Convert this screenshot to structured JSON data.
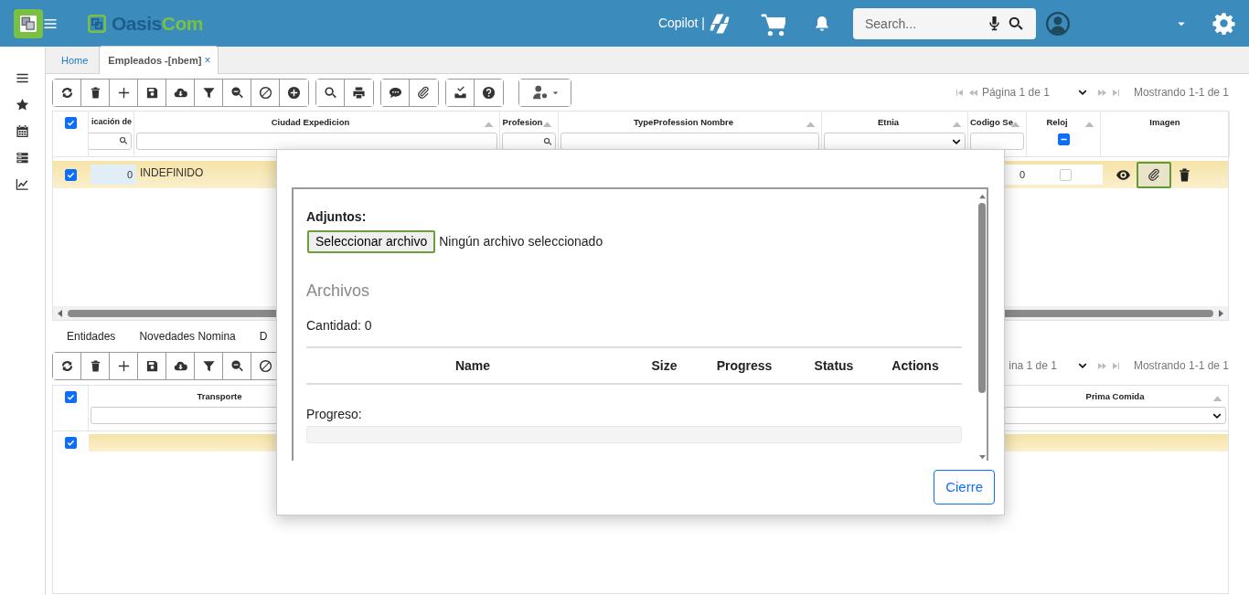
{
  "header": {
    "brand_parts": [
      "Oasis",
      "Com"
    ],
    "copilot_label": "Copilot |",
    "search": {
      "placeholder": "Search..."
    }
  },
  "tabs": [
    {
      "label": "Home",
      "selected": false,
      "closable": false
    },
    {
      "label": "Empleados -[nbem]",
      "selected": true,
      "closable": true,
      "close_glyph": "×"
    }
  ],
  "pagination": {
    "page_text": "Página 1 de 1",
    "showing": "Mostrando 1-1 de 1"
  },
  "grid": {
    "select_all_checked": true,
    "columns": [
      {
        "label": "icación de",
        "sortable": false,
        "kind": "search"
      },
      {
        "label": "Ciudad Expedicion",
        "sortable": true,
        "kind": "text"
      },
      {
        "label": "Profesion",
        "sortable": true,
        "kind": "search"
      },
      {
        "label": "TypeProfession Nombre",
        "sortable": true,
        "kind": "text"
      },
      {
        "label": "Etnia",
        "sortable": true,
        "kind": "select"
      },
      {
        "label": "Codigo Se",
        "sortable": true,
        "kind": "text"
      },
      {
        "label": "Reloj",
        "sortable": true,
        "kind": "checkbox",
        "indeterminate": true
      },
      {
        "label": "Imagen",
        "sortable": false,
        "kind": "actions"
      }
    ],
    "rows": [
      {
        "selected": true,
        "code": "0",
        "ciudad": "INDEFINIDO",
        "codigo": "0",
        "reloj": false,
        "attach_highlighted": true
      }
    ]
  },
  "subtabs": [
    "Entidades",
    "Novedades Nomina",
    "D"
  ],
  "pagination_2": {
    "page_text": "ina 1 de 1",
    "showing": "Mostrando 1-1 de 1"
  },
  "grid_2": {
    "select_all_checked": true,
    "columns": [
      {
        "label": "Transporte",
        "sortable": false,
        "kind": "text"
      },
      {
        "label": "Prima Comida",
        "sortable": true,
        "kind": "select"
      }
    ],
    "rows": [
      {
        "selected": true
      }
    ]
  },
  "modal": {
    "field_label": "Adjuntos:",
    "file_button": {
      "label": "Seleccionar archivo",
      "highlighted": true
    },
    "file_status": "Ningún archivo seleccionado",
    "section_title": "Archivos",
    "count": "Cantidad: 0",
    "table_columns": [
      "Name",
      "Size",
      "Progress",
      "Status",
      "Actions"
    ],
    "progress_label": "Progreso:",
    "progress": {
      "level": 0
    },
    "close_button": "Cierre"
  }
}
